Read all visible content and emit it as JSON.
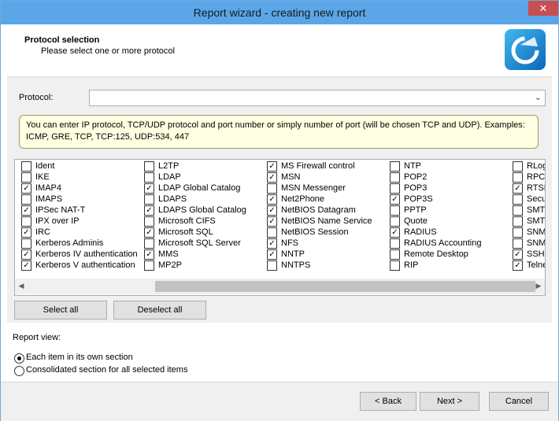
{
  "window": {
    "title": "Report wizard - creating new report",
    "close_glyph": "✕"
  },
  "header": {
    "title": "Protocol selection",
    "subtitle": "Please select one or more protocol",
    "logo_icon": "report-wizard-logo"
  },
  "protocol": {
    "label": "Protocol:",
    "value": "",
    "dropdown_glyph": "⌄"
  },
  "info": {
    "text": "You can enter IP protocol, TCP/UDP protocol and port number or simply number of port (will be chosen TCP and UDP). Examples: ICMP, GRE, TCP, TCP:125, UDP:534, 447"
  },
  "columns": [
    [
      {
        "label": "Ident",
        "checked": false
      },
      {
        "label": "IKE",
        "checked": false
      },
      {
        "label": "IMAP4",
        "checked": true
      },
      {
        "label": "IMAPS",
        "checked": false
      },
      {
        "label": "IPSec NAT-T",
        "checked": true
      },
      {
        "label": "IPX over IP",
        "checked": false
      },
      {
        "label": "IRC",
        "checked": true
      },
      {
        "label": "Kerberos Adminis",
        "checked": false
      },
      {
        "label": "Kerberos IV authentication",
        "checked": true
      },
      {
        "label": "Kerberos V authentication",
        "checked": true
      }
    ],
    [
      {
        "label": "L2TP",
        "checked": false
      },
      {
        "label": "LDAP",
        "checked": false
      },
      {
        "label": "LDAP Global Catalog",
        "checked": true
      },
      {
        "label": "LDAPS",
        "checked": false
      },
      {
        "label": "LDAPS Global Catalog",
        "checked": true
      },
      {
        "label": "Microsoft CIFS",
        "checked": false
      },
      {
        "label": "Microsoft SQL",
        "checked": true
      },
      {
        "label": "Microsoft SQL Server",
        "checked": false
      },
      {
        "label": "MMS",
        "checked": true
      },
      {
        "label": "MP2P",
        "checked": false
      }
    ],
    [
      {
        "label": "MS Firewall control",
        "checked": true
      },
      {
        "label": "MSN",
        "checked": true
      },
      {
        "label": "MSN Messenger",
        "checked": false
      },
      {
        "label": "Net2Phone",
        "checked": true
      },
      {
        "label": "NetBIOS Datagram",
        "checked": true
      },
      {
        "label": "NetBIOS Name Service",
        "checked": true
      },
      {
        "label": "NetBIOS Session",
        "checked": false
      },
      {
        "label": "NFS",
        "checked": true
      },
      {
        "label": "NNTP",
        "checked": true
      },
      {
        "label": "NNTPS",
        "checked": false
      }
    ],
    [
      {
        "label": "NTP",
        "checked": false
      },
      {
        "label": "POP2",
        "checked": false
      },
      {
        "label": "POP3",
        "checked": false
      },
      {
        "label": "POP3S",
        "checked": true
      },
      {
        "label": "PPTP",
        "checked": false
      },
      {
        "label": "Quote",
        "checked": false
      },
      {
        "label": "RADIUS",
        "checked": true
      },
      {
        "label": "RADIUS Accounting",
        "checked": false
      },
      {
        "label": "Remote Desktop",
        "checked": false
      },
      {
        "label": "RIP",
        "checked": false
      }
    ],
    [
      {
        "label": "RLogin",
        "checked": false
      },
      {
        "label": "RPC",
        "checked": false
      },
      {
        "label": "RTSP",
        "checked": true
      },
      {
        "label": "SecurID",
        "checked": false
      },
      {
        "label": "SMTP",
        "checked": false
      },
      {
        "label": "SMTPS",
        "checked": false
      },
      {
        "label": "SNMP",
        "checked": false
      },
      {
        "label": "SNMP Trap",
        "checked": false
      },
      {
        "label": "SSH",
        "checked": true
      },
      {
        "label": "Telnet",
        "checked": true
      }
    ]
  ],
  "scroll": {
    "left_glyph": "◀",
    "right_glyph": "▶"
  },
  "select_all": "Select all",
  "deselect_all": "Deselect all",
  "report_view": {
    "label": "Report view:",
    "options": [
      {
        "label": "Each item in its own section",
        "selected": true
      },
      {
        "label": "Consolidated section for all selected items",
        "selected": false
      }
    ]
  },
  "footer": {
    "back": "< Back",
    "next": "Next >",
    "cancel": "Cancel"
  }
}
